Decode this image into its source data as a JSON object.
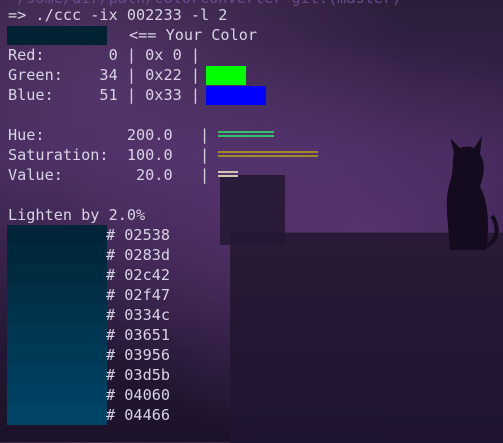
{
  "prompt_line": "=> ./ccc -ix 002233 -l 2",
  "top_partial": "~/some/dir/path/colorconverter git:(master)",
  "your_color_label": "<== Your Color",
  "color_hex": "#002233",
  "rgb": [
    {
      "label": "Red:",
      "dec": "0",
      "hex": "0x 0",
      "bar_color": "#00ff00",
      "value": 0
    },
    {
      "label": "Green:",
      "dec": "34",
      "hex": "0x22",
      "bar_color": "#00ff00",
      "value": 34
    },
    {
      "label": "Blue:",
      "dec": "51",
      "hex": "0x33",
      "bar_color": "#0000ff",
      "value": 51
    }
  ],
  "hsv": [
    {
      "label": "Hue:",
      "value_text": "200.0",
      "bar_color": "#35c06a",
      "fraction": 0.556
    },
    {
      "label": "Saturation:",
      "value_text": "100.0",
      "bar_color": "#a08a2a",
      "fraction": 1.0
    },
    {
      "label": "Value:",
      "value_text": "20.0",
      "bar_color": "#cfc7b0",
      "fraction": 0.2
    }
  ],
  "lighten_label": "Lighten by 2.0%",
  "tints": [
    {
      "hex": "02538",
      "color": "#002538"
    },
    {
      "hex": "0283d",
      "color": "#00283d"
    },
    {
      "hex": "02c42",
      "color": "#002c42"
    },
    {
      "hex": "02f47",
      "color": "#002f47"
    },
    {
      "hex": "0334c",
      "color": "#00334c"
    },
    {
      "hex": "03651",
      "color": "#003651"
    },
    {
      "hex": "03956",
      "color": "#003956"
    },
    {
      "hex": "03d5b",
      "color": "#003d5b"
    },
    {
      "hex": "04060",
      "color": "#004060"
    },
    {
      "hex": "04466",
      "color": "#004466"
    }
  ]
}
